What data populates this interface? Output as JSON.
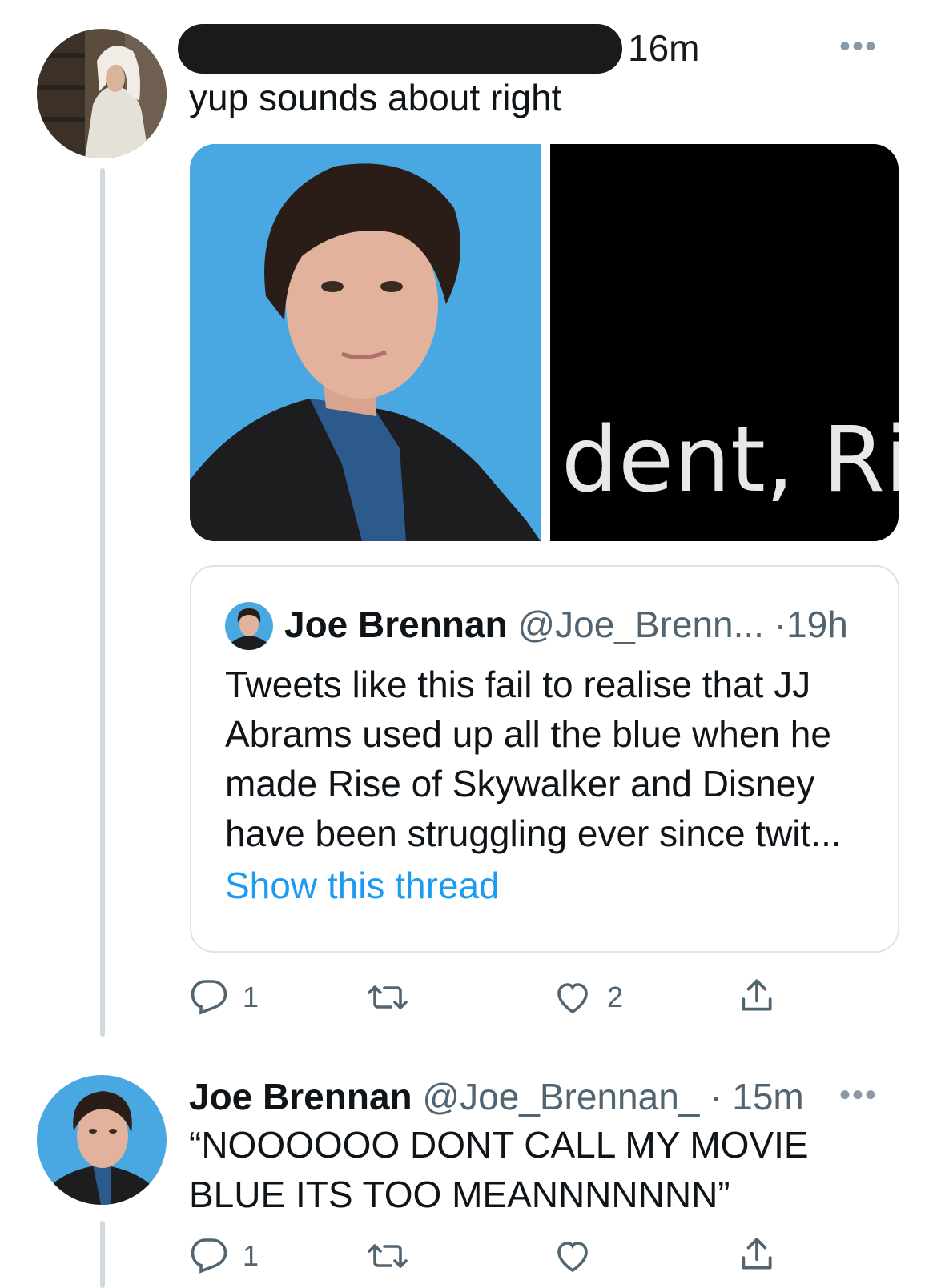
{
  "tweet1": {
    "time": "16m",
    "more": "•••",
    "text": "yup sounds about right",
    "media_caption_fragment": "dent, Ri",
    "quote": {
      "name": "Joe Brennan",
      "handle": "@Joe_Brenn...",
      "dot": "·",
      "time": "19h",
      "body": "Tweets like this fail to realise that JJ Abrams used up all the blue when he made Rise of Skywalker and Disney have been struggling ever since twit...",
      "show_thread": "Show this thread"
    },
    "actions": {
      "reply_count": "1",
      "retweet_count": "",
      "like_count": "2",
      "reply_icon": "reply-icon",
      "retweet_icon": "retweet-icon",
      "like_icon": "like-icon",
      "share_icon": "share-icon"
    }
  },
  "tweet2": {
    "name": "Joe Brennan",
    "handle": "@Joe_Brennan_",
    "dot": "·",
    "time": "15m",
    "more": "•••",
    "text_line1": "“NOOOOOO DONT CALL MY MOVIE",
    "text_line2": "BLUE ITS TOO MEANNNNNNN”",
    "actions": {
      "reply_count": "1",
      "retweet_count": "",
      "like_count": ""
    }
  },
  "colors": {
    "accent": "#1d9bf0",
    "muted": "#536471",
    "thread_line": "#cfd9de",
    "photo_bg": "#49a8e1"
  }
}
